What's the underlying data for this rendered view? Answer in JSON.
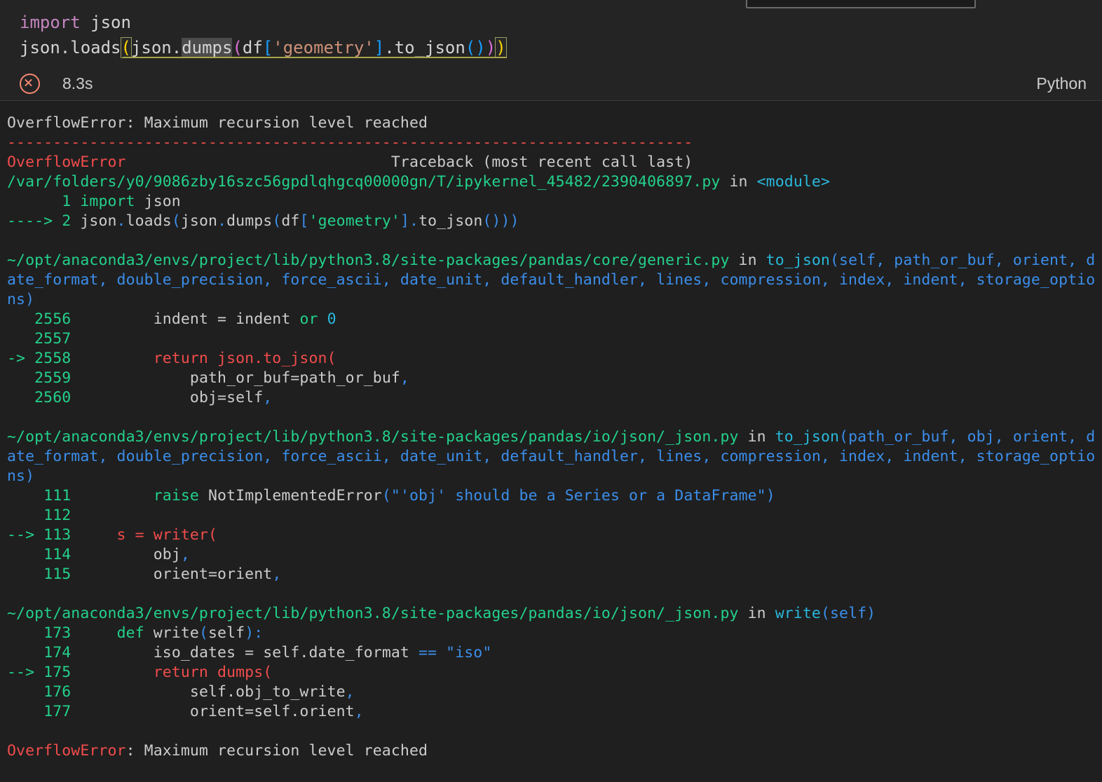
{
  "editor": {
    "lines": [
      {
        "tokens": [
          {
            "t": "import",
            "c": "e-kw"
          },
          {
            "t": " json",
            "c": "e-plain"
          }
        ]
      },
      {
        "tokens": [
          {
            "t": "json",
            "c": "e-plain"
          },
          {
            "t": ".",
            "c": "e-plain"
          },
          {
            "t": "loads",
            "c": "e-plain"
          },
          {
            "t": "(",
            "c": "e-paren-y",
            "box": true
          },
          {
            "t": "json",
            "c": "e-plain"
          },
          {
            "t": ".",
            "c": "e-plain"
          },
          {
            "t": "dumps",
            "c": "e-plain",
            "sel": true
          },
          {
            "t": "(",
            "c": "e-paren-m"
          },
          {
            "t": "df",
            "c": "e-plain"
          },
          {
            "t": "[",
            "c": "e-brk"
          },
          {
            "t": "'geometry'",
            "c": "e-str"
          },
          {
            "t": "]",
            "c": "e-brk"
          },
          {
            "t": ".",
            "c": "e-plain"
          },
          {
            "t": "to_json",
            "c": "e-plain"
          },
          {
            "t": "(",
            "c": "e-paren-b"
          },
          {
            "t": ")",
            "c": "e-paren-b"
          },
          {
            "t": ")",
            "c": "e-paren-m"
          },
          {
            "t": ")",
            "c": "e-paren-y",
            "box": true
          }
        ]
      }
    ]
  },
  "status": {
    "error_icon": "error-circle-x-icon",
    "execution_time": "8.3s",
    "kernel": "Python"
  },
  "traceback": {
    "lines": [
      {
        "segs": [
          {
            "t": "OverflowError: Maximum recursion level reached",
            "c": "t-white"
          }
        ]
      },
      {
        "segs": [
          {
            "t": "---------------------------------------------------------------------------",
            "c": "t-rule"
          }
        ]
      },
      {
        "segs": [
          {
            "t": "OverflowError",
            "c": "t-err"
          },
          {
            "t": "                             Traceback (most recent call last)",
            "c": "t-white"
          }
        ]
      },
      {
        "segs": [
          {
            "t": "/var/folders/y0/9086zby16szc56gpdlqhgcq00000gn/T/ipykernel_45482/2390406897.py",
            "c": "t-path"
          },
          {
            "t": " in ",
            "c": "t-white"
          },
          {
            "t": "<module>",
            "c": "t-cyan"
          }
        ]
      },
      {
        "segs": [
          {
            "t": "      1 ",
            "c": "t-lineno"
          },
          {
            "t": "import",
            "c": "t-green"
          },
          {
            "t": " json",
            "c": "t-white"
          }
        ]
      },
      {
        "segs": [
          {
            "t": "----> 2 ",
            "c": "t-lineno"
          },
          {
            "t": "json",
            "c": "t-white"
          },
          {
            "t": ".",
            "c": "t-blue"
          },
          {
            "t": "loads",
            "c": "t-white"
          },
          {
            "t": "(",
            "c": "t-blue"
          },
          {
            "t": "json",
            "c": "t-white"
          },
          {
            "t": ".",
            "c": "t-blue"
          },
          {
            "t": "dumps",
            "c": "t-white"
          },
          {
            "t": "(",
            "c": "t-blue"
          },
          {
            "t": "df",
            "c": "t-white"
          },
          {
            "t": "[",
            "c": "t-blue"
          },
          {
            "t": "'geometry'",
            "c": "t-green"
          },
          {
            "t": "]",
            "c": "t-blue"
          },
          {
            "t": ".",
            "c": "t-blue"
          },
          {
            "t": "to_json",
            "c": "t-white"
          },
          {
            "t": "()))",
            "c": "t-blue"
          }
        ]
      },
      {
        "blank": true
      },
      {
        "segs": [
          {
            "t": "~/opt/anaconda3/envs/project/lib/python3.8/site-packages/pandas/core/generic.py",
            "c": "t-path"
          },
          {
            "t": " in ",
            "c": "t-white"
          },
          {
            "t": "to_json",
            "c": "t-func"
          },
          {
            "t": "(self, path_or_buf, orient, date_format, double_precision, force_ascii, date_unit, default_handler, lines, compression, index, indent, storage_options)",
            "c": "t-arg"
          }
        ]
      },
      {
        "segs": [
          {
            "t": "   2556 ",
            "c": "t-lineno"
          },
          {
            "t": "        indent = indent ",
            "c": "t-white"
          },
          {
            "t": "or",
            "c": "t-green"
          },
          {
            "t": " ",
            "c": "t-white"
          },
          {
            "t": "0",
            "c": "t-cyan"
          }
        ]
      },
      {
        "segs": [
          {
            "t": "   2557 ",
            "c": "t-lineno"
          }
        ]
      },
      {
        "segs": [
          {
            "t": "-> 2558 ",
            "c": "t-lineno"
          },
          {
            "t": "        return json.to_json(",
            "c": "t-cur"
          }
        ]
      },
      {
        "segs": [
          {
            "t": "   2559 ",
            "c": "t-lineno"
          },
          {
            "t": "            path_or_buf=path_or_buf",
            "c": "t-white"
          },
          {
            "t": ",",
            "c": "t-blue"
          }
        ]
      },
      {
        "segs": [
          {
            "t": "   2560 ",
            "c": "t-lineno"
          },
          {
            "t": "            obj=self",
            "c": "t-white"
          },
          {
            "t": ",",
            "c": "t-blue"
          }
        ]
      },
      {
        "blank": true
      },
      {
        "segs": [
          {
            "t": "~/opt/anaconda3/envs/project/lib/python3.8/site-packages/pandas/io/json/_json.py",
            "c": "t-path"
          },
          {
            "t": " in ",
            "c": "t-white"
          },
          {
            "t": "to_json",
            "c": "t-func"
          },
          {
            "t": "(path_or_buf, obj, orient, date_format, double_precision, force_ascii, date_unit, default_handler, lines, compression, index, indent, storage_options)",
            "c": "t-arg"
          }
        ]
      },
      {
        "segs": [
          {
            "t": "    111 ",
            "c": "t-lineno"
          },
          {
            "t": "        ",
            "c": "t-white"
          },
          {
            "t": "raise",
            "c": "t-green"
          },
          {
            "t": " NotImplementedError",
            "c": "t-white"
          },
          {
            "t": "(",
            "c": "t-blue"
          },
          {
            "t": "\"'obj' should be a Series or a DataFrame\"",
            "c": "t-str"
          },
          {
            "t": ")",
            "c": "t-blue"
          }
        ]
      },
      {
        "segs": [
          {
            "t": "    112 ",
            "c": "t-lineno"
          }
        ]
      },
      {
        "segs": [
          {
            "t": "--> 113 ",
            "c": "t-lineno"
          },
          {
            "t": "    s = writer(",
            "c": "t-cur"
          }
        ]
      },
      {
        "segs": [
          {
            "t": "    114 ",
            "c": "t-lineno"
          },
          {
            "t": "        obj",
            "c": "t-white"
          },
          {
            "t": ",",
            "c": "t-blue"
          }
        ]
      },
      {
        "segs": [
          {
            "t": "    115 ",
            "c": "t-lineno"
          },
          {
            "t": "        orient=orient",
            "c": "t-white"
          },
          {
            "t": ",",
            "c": "t-blue"
          }
        ]
      },
      {
        "blank": true
      },
      {
        "segs": [
          {
            "t": "~/opt/anaconda3/envs/project/lib/python3.8/site-packages/pandas/io/json/_json.py",
            "c": "t-path"
          },
          {
            "t": " in ",
            "c": "t-white"
          },
          {
            "t": "write",
            "c": "t-func"
          },
          {
            "t": "(self)",
            "c": "t-arg"
          }
        ]
      },
      {
        "segs": [
          {
            "t": "    173 ",
            "c": "t-lineno"
          },
          {
            "t": "    ",
            "c": "t-white"
          },
          {
            "t": "def",
            "c": "t-green"
          },
          {
            "t": " write",
            "c": "t-white"
          },
          {
            "t": "(",
            "c": "t-blue"
          },
          {
            "t": "self",
            "c": "t-white"
          },
          {
            "t": "):",
            "c": "t-blue"
          }
        ]
      },
      {
        "segs": [
          {
            "t": "    174 ",
            "c": "t-lineno"
          },
          {
            "t": "        iso_dates = self.date_format ",
            "c": "t-white"
          },
          {
            "t": "==",
            "c": "t-blue"
          },
          {
            "t": " ",
            "c": "t-white"
          },
          {
            "t": "\"iso\"",
            "c": "t-str"
          }
        ]
      },
      {
        "segs": [
          {
            "t": "--> 175 ",
            "c": "t-lineno"
          },
          {
            "t": "        return dumps(",
            "c": "t-cur"
          }
        ]
      },
      {
        "segs": [
          {
            "t": "    176 ",
            "c": "t-lineno"
          },
          {
            "t": "            self.obj_to_write",
            "c": "t-white"
          },
          {
            "t": ",",
            "c": "t-blue"
          }
        ]
      },
      {
        "segs": [
          {
            "t": "    177 ",
            "c": "t-lineno"
          },
          {
            "t": "            orient=self.orient",
            "c": "t-white"
          },
          {
            "t": ",",
            "c": "t-blue"
          }
        ]
      },
      {
        "blank": true
      },
      {
        "segs": [
          {
            "t": "OverflowError",
            "c": "t-err"
          },
          {
            "t": ": Maximum recursion level reached",
            "c": "t-white"
          }
        ]
      }
    ]
  },
  "colors": {
    "editor_bg": "#242424",
    "output_bg": "#1f1f1f",
    "error_red": "#f14c4c",
    "path_green": "#23d18b",
    "func_cyan": "#29b8db",
    "arg_blue": "#3b8eea",
    "error_icon": "#f48771",
    "bracket_yellow": "#ffd700"
  }
}
